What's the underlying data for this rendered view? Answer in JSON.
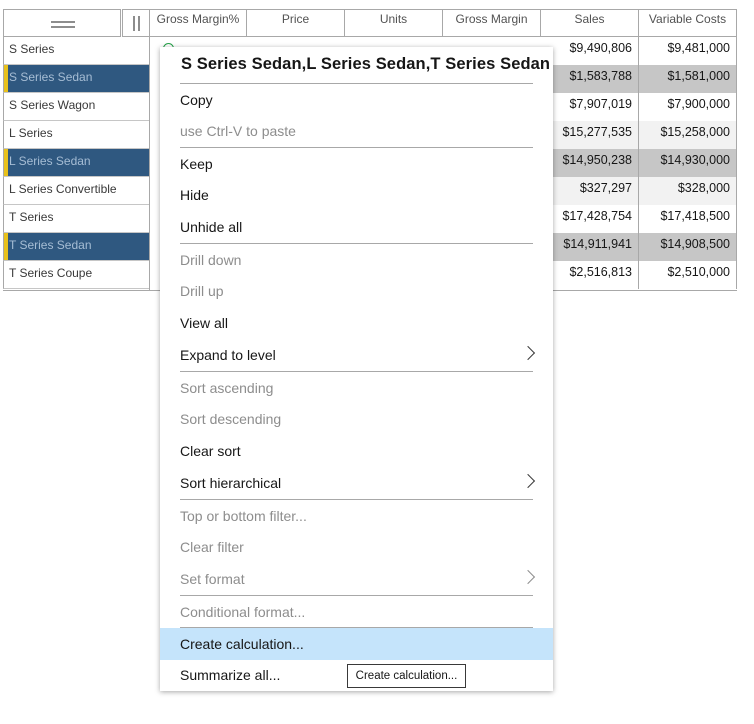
{
  "crosstab": {
    "columns": [
      "Gross Margin%",
      "Price",
      "Units",
      "Gross Margin",
      "Sales",
      "Variable Costs"
    ],
    "rows": [
      {
        "label": "S Series",
        "selected": false,
        "sales": "$9,490,806",
        "variable_costs": "$9,481,000"
      },
      {
        "label": "S Series Sedan",
        "selected": true,
        "sales": "$1,583,788",
        "variable_costs": "$1,581,000"
      },
      {
        "label": "S Series Wagon",
        "selected": false,
        "sales": "$7,907,019",
        "variable_costs": "$7,900,000"
      },
      {
        "label": "L Series",
        "selected": false,
        "sales": "$15,277,535",
        "variable_costs": "$15,258,000"
      },
      {
        "label": "L Series Sedan",
        "selected": true,
        "sales": "$14,950,238",
        "variable_costs": "$14,930,000"
      },
      {
        "label": "L Series Convertible",
        "selected": false,
        "sales": "$327,297",
        "variable_costs": "$328,000"
      },
      {
        "label": "T Series",
        "selected": false,
        "sales": "$17,428,754",
        "variable_costs": "$17,418,500"
      },
      {
        "label": "T Series Sedan",
        "selected": true,
        "sales": "$14,911,941",
        "variable_costs": "$14,908,500"
      },
      {
        "label": "T Series Coupe",
        "selected": false,
        "sales": "$2,516,813",
        "variable_costs": "$2,510,000"
      }
    ]
  },
  "menu": {
    "title": "S Series Sedan,L Series Sedan,T Series Sedan",
    "items": [
      {
        "label": "Copy",
        "disabled": false
      },
      {
        "label": "use Ctrl-V to paste",
        "disabled": true
      },
      {
        "label": "Keep",
        "disabled": false
      },
      {
        "label": "Hide",
        "disabled": false
      },
      {
        "label": "Unhide all",
        "disabled": false
      },
      {
        "label": "Drill down",
        "disabled": true
      },
      {
        "label": "Drill up",
        "disabled": true
      },
      {
        "label": "View all",
        "disabled": false
      },
      {
        "label": "Expand to level",
        "disabled": false
      },
      {
        "label": "Sort ascending",
        "disabled": true
      },
      {
        "label": "Sort descending",
        "disabled": true
      },
      {
        "label": "Clear sort",
        "disabled": false
      },
      {
        "label": "Sort hierarchical",
        "disabled": false
      },
      {
        "label": "Top or bottom filter...",
        "disabled": true
      },
      {
        "label": "Clear filter",
        "disabled": true
      },
      {
        "label": "Set format",
        "disabled": true
      },
      {
        "label": "Conditional format...",
        "disabled": true
      },
      {
        "label": "Create calculation...",
        "disabled": false
      },
      {
        "label": "Summarize all...",
        "disabled": false
      }
    ],
    "tooltip": "Create calculation...",
    "hover_color": "#c5e4fb"
  },
  "colors": {
    "selected_row": "#2f5880",
    "selection_marker": "#e8c11c"
  }
}
